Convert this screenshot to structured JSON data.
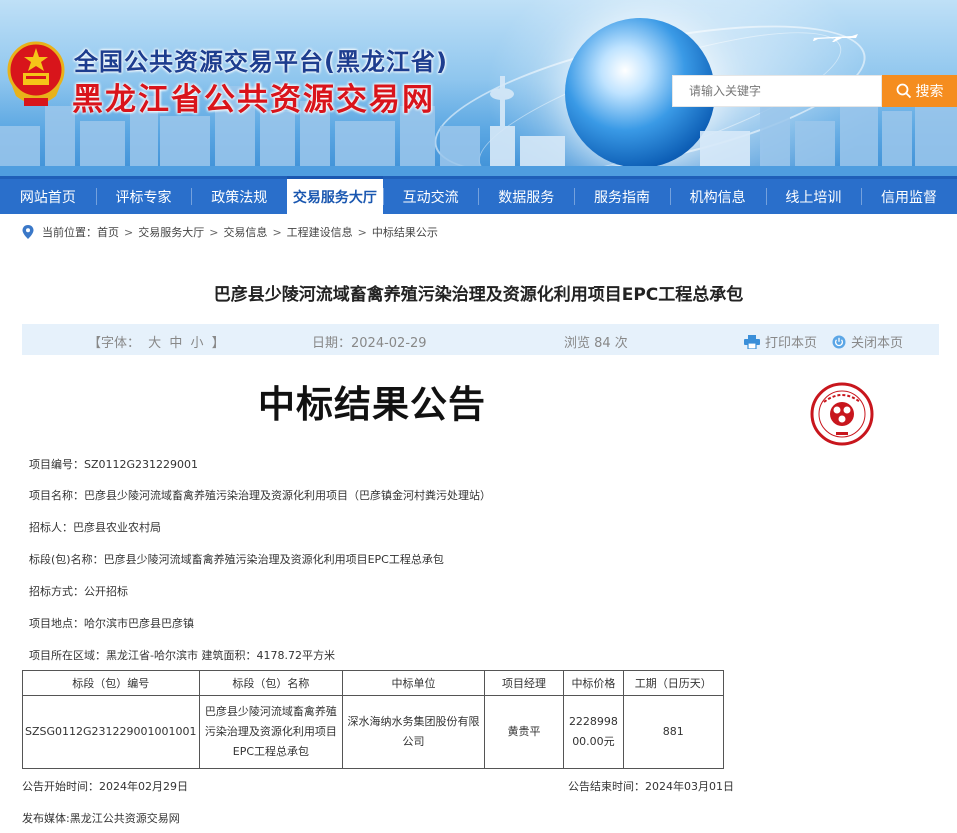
{
  "header": {
    "title_line1": "全国公共资源交易平台(黑龙江省)",
    "title_line2": "黑龙江省公共资源交易网",
    "search": {
      "placeholder": "请输入关键字",
      "button_label": "搜索"
    }
  },
  "nav": {
    "items": [
      {
        "label": "网站首页"
      },
      {
        "label": "评标专家"
      },
      {
        "label": "政策法规"
      },
      {
        "label": "交易服务大厅"
      },
      {
        "label": "互动交流"
      },
      {
        "label": "数据服务"
      },
      {
        "label": "服务指南"
      },
      {
        "label": "机构信息"
      },
      {
        "label": "线上培训"
      },
      {
        "label": "信用监督"
      }
    ],
    "active_index": 3
  },
  "breadcrumb": {
    "prefix": "当前位置：",
    "items": [
      "首页",
      "交易服务大厅",
      "交易信息",
      "工程建设信息",
      "中标结果公示"
    ]
  },
  "article": {
    "title": "巴彦县少陵河流域畜禽养殖污染治理及资源化利用项目EPC工程总承包",
    "font_label": "【字体：",
    "font_large": "大",
    "font_medium": "中",
    "font_small": "小",
    "font_close": "】",
    "date": "日期：2024-02-29",
    "views": "浏览 84 次",
    "print_label": "打印本页",
    "close_label": "关闭本页"
  },
  "notice": {
    "heading": "中标结果公告",
    "project_code": "项目编号：SZ0112G231229001",
    "project_name": "项目名称：巴彦县少陵河流域畜禽养殖污染治理及资源化利用项目（巴彦镇金河村粪污处理站）",
    "tenderer": "招标人：巴彦县农业农村局",
    "section_name": "标段(包)名称：巴彦县少陵河流域畜禽养殖污染治理及资源化利用项目EPC工程总承包",
    "tender_method": "招标方式：公开招标",
    "location": "项目地点：哈尔滨市巴彦县巴彦镇",
    "region": "项目所在区域：黑龙江省-哈尔滨市  建筑面积：4178.72平方米",
    "table": {
      "headers": [
        "标段（包）编号",
        "标段（包）名称",
        "中标单位",
        "项目经理",
        "中标价格",
        "工期（日历天）"
      ],
      "rows": [
        [
          "SZSG0112G231229001001001",
          "巴彦县少陵河流域畜禽养殖污染治理及资源化利用项目EPC工程总承包",
          "深水海纳水务集团股份有限公司",
          "黄贵平",
          "222899800.00元",
          "881"
        ]
      ]
    },
    "start_time": "公告开始时间：2024年02月29日",
    "end_time": "公告结束时间：2024年03月01日",
    "media": "发布媒体:黑龙江公共资源交易网"
  },
  "colors": {
    "nav_bg": "#2a6fcb",
    "search_btn": "#f58d1f",
    "title_red": "#d9141b",
    "title_blue": "#1d3d8f",
    "info_bar_bg": "#e6f1fb",
    "seal_red": "#c8161d"
  }
}
